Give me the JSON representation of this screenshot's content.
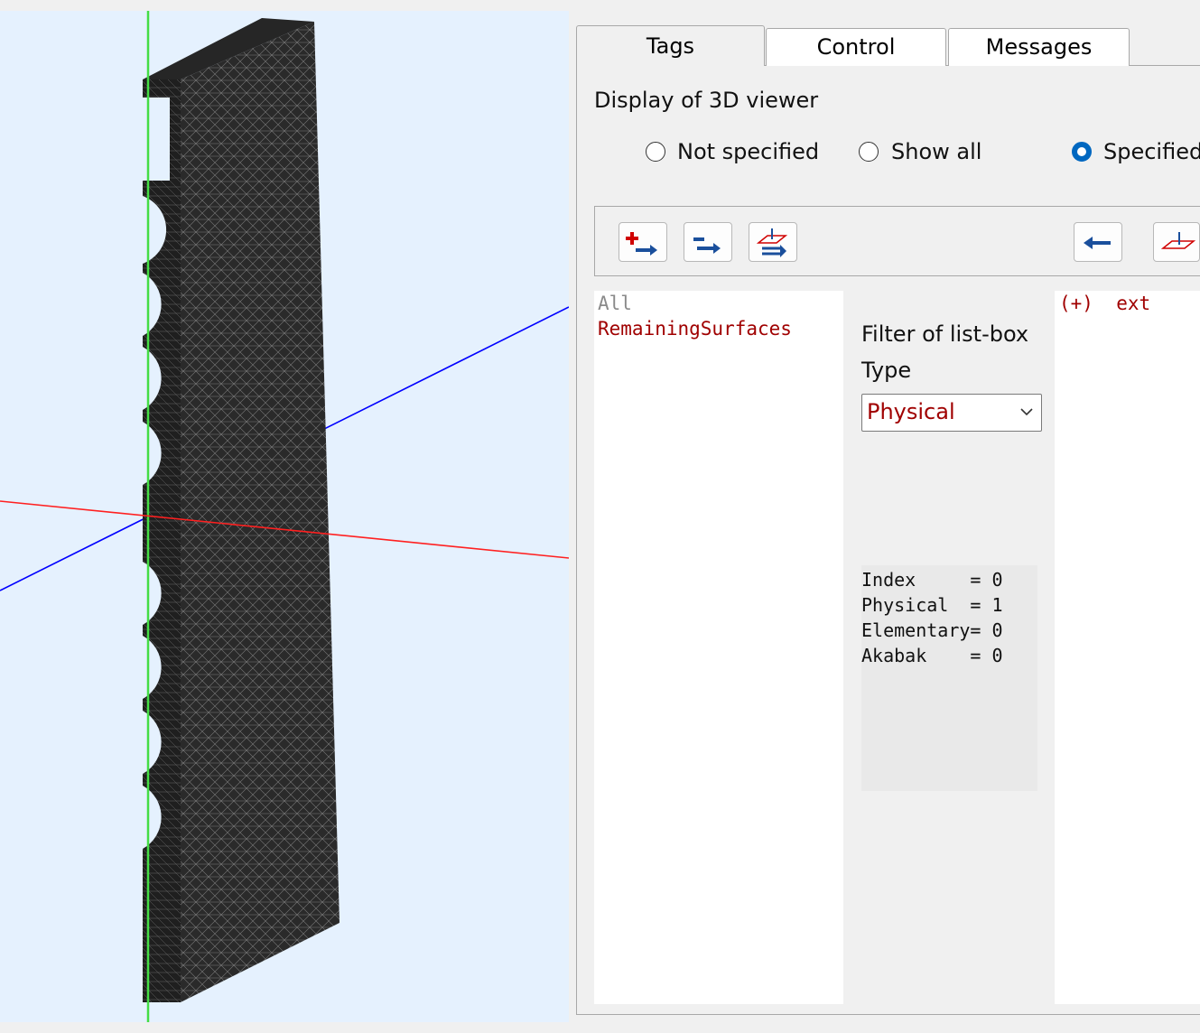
{
  "tabs": [
    {
      "label": "Tags",
      "active": true
    },
    {
      "label": "Control",
      "active": false
    },
    {
      "label": "Messages",
      "active": false
    }
  ],
  "display_section": {
    "title": "Display of 3D viewer",
    "options": [
      {
        "label": "Not specified",
        "checked": false
      },
      {
        "label": "Show all",
        "checked": false
      },
      {
        "label": "Specified",
        "checked": true
      }
    ]
  },
  "toolbar": {
    "buttons": [
      "add-right-icon",
      "remove-right-icon",
      "plane-right-icon",
      "arrow-left-icon",
      "plane-icon"
    ]
  },
  "left_list": {
    "items": [
      {
        "text": "All",
        "color": "#8a8a8a"
      },
      {
        "text": "RemainingSurfaces",
        "color": "#a00000"
      }
    ]
  },
  "filter": {
    "title": "Filter of list-box",
    "type_label": "Type",
    "selected": "Physical"
  },
  "info": {
    "lines": [
      "Index     = 0",
      "Physical  = 1",
      "Elementary= 0",
      "Akabak    = 0"
    ]
  },
  "right_list": {
    "items": [
      {
        "text": "(+)  ext",
        "color": "#a00000"
      }
    ]
  },
  "colors": {
    "viewer_bg": "#e5f1fe",
    "axis_x": "#ff0000",
    "axis_y": "#00cc00",
    "axis_z": "#0000ff",
    "accent": "#0067c0",
    "tag_text": "#a00000"
  }
}
